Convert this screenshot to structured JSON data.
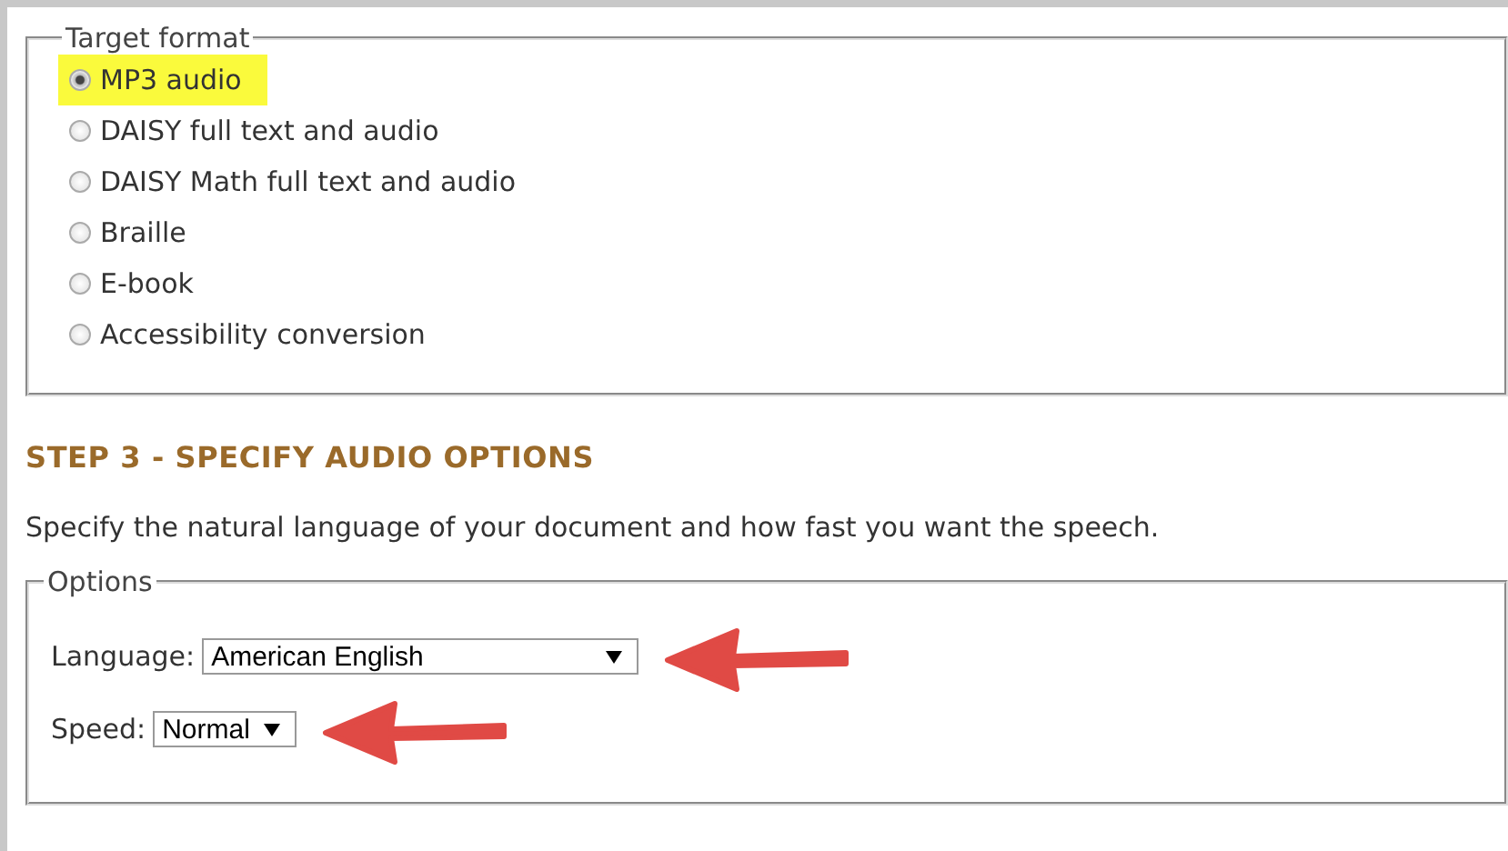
{
  "target_format": {
    "legend": "Target format",
    "options": [
      {
        "label": "MP3 audio",
        "selected": true
      },
      {
        "label": "DAISY full text and audio",
        "selected": false
      },
      {
        "label": "DAISY Math full text and audio",
        "selected": false
      },
      {
        "label": "Braille",
        "selected": false
      },
      {
        "label": "E-book",
        "selected": false
      },
      {
        "label": "Accessibility conversion",
        "selected": false
      }
    ]
  },
  "step_heading": "STEP 3 - SPECIFY AUDIO OPTIONS",
  "description": "Specify the natural language of your document and how fast you want the speech.",
  "options": {
    "legend": "Options",
    "fields": [
      {
        "label": "Language:",
        "value": "American English"
      },
      {
        "label": "Speed:",
        "value": "Normal"
      }
    ]
  }
}
